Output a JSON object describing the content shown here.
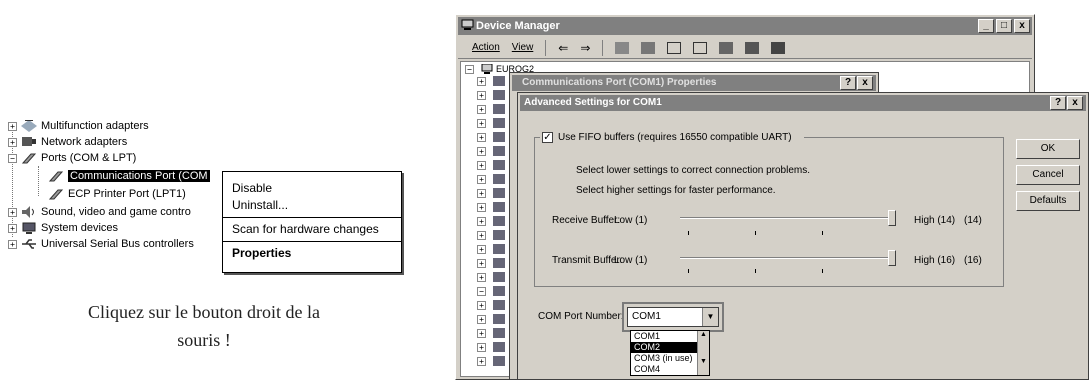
{
  "left_tree": {
    "items": [
      {
        "label": "Multifunction adapters",
        "icon": "multifunction-icon"
      },
      {
        "label": "Network adapters",
        "icon": "network-icon"
      },
      {
        "label": "Ports (COM & LPT)",
        "icon": "ports-icon"
      },
      {
        "label": "Communications Port (COM",
        "icon": "port-icon"
      },
      {
        "label": "ECP Printer Port (LPT1)",
        "icon": "printer-port-icon"
      },
      {
        "label": "Sound, video and game contro",
        "icon": "sound-icon"
      },
      {
        "label": "System devices",
        "icon": "system-icon"
      },
      {
        "label": "Universal Serial Bus controllers",
        "icon": "usb-icon"
      }
    ]
  },
  "context_menu": {
    "disable": "Disable",
    "uninstall": "Uninstall...",
    "scan": "Scan for hardware changes",
    "properties": "Properties"
  },
  "caption": {
    "line1": "Cliquez sur le bouton droit de la",
    "line2": "souris !"
  },
  "device_manager": {
    "title": "Device Manager",
    "menu": {
      "action": "Action",
      "view": "View"
    },
    "root": "EUROG2",
    "window_buttons": {
      "minimize": "_",
      "maximize": "□",
      "close": "x"
    }
  },
  "properties_dialog": {
    "title": "Communications Port (COM1) Properties",
    "help": "?",
    "close": "x"
  },
  "advanced_dialog": {
    "title": "Advanced Settings for COM1",
    "help": "?",
    "close": "x",
    "fifo_label": "Use FIFO buffers (requires 16550 compatible UART)",
    "fifo_checked": true,
    "hint1": "Select lower settings to correct connection problems.",
    "hint2": "Select higher settings for faster performance.",
    "receive": {
      "label": "Receive Buffer:",
      "low": "Low (1)",
      "high": "High (14)",
      "value": "(14)",
      "level": 1.0
    },
    "transmit": {
      "label": "Transmit Buffer:",
      "low": "Low (1)",
      "high": "High (16)",
      "value": "(16)",
      "level": 1.0
    },
    "ok": "OK",
    "cancel": "Cancel",
    "defaults": "Defaults",
    "com_port_label": "COM Port Number:",
    "com_port_value": "COM1",
    "dropdown_options": [
      "COM1",
      "COM2",
      "COM3 (in use)",
      "COM4"
    ],
    "dropdown_selected": "COM2"
  }
}
